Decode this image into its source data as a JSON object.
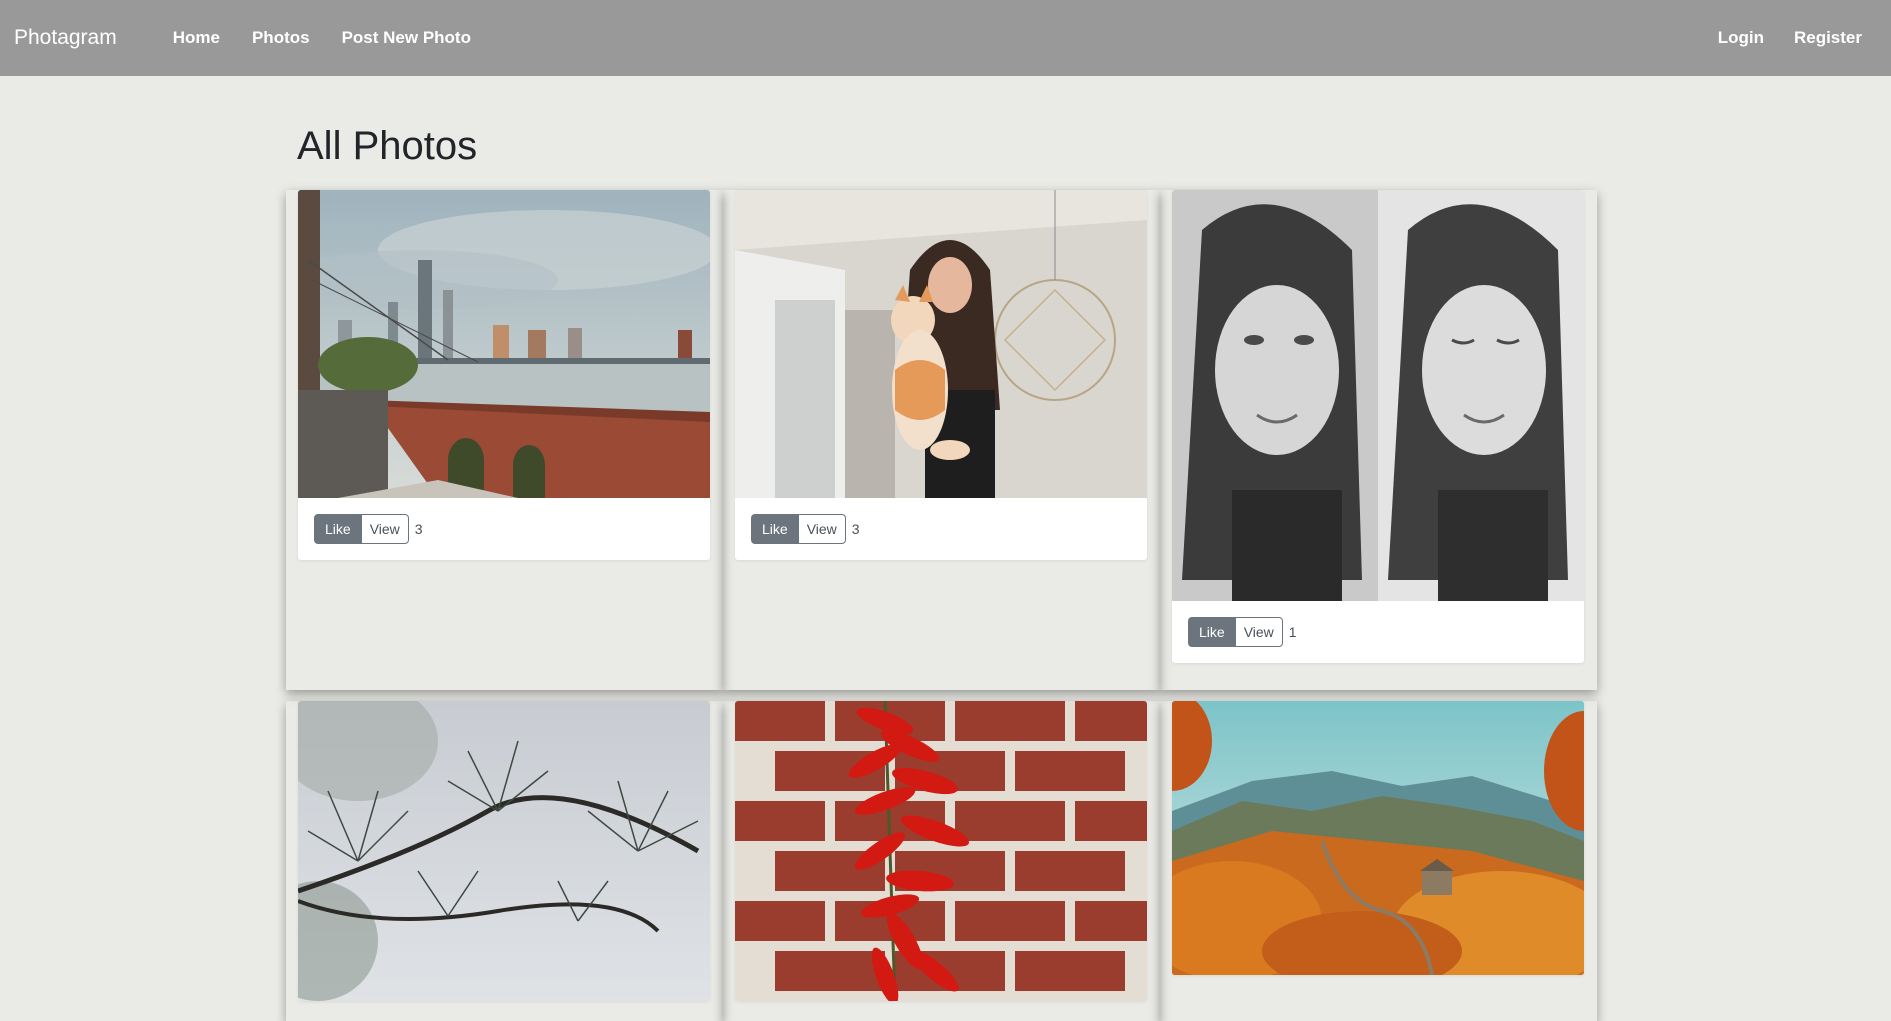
{
  "nav": {
    "brand": "Photagram",
    "links": [
      "Home",
      "Photos",
      "Post New Photo"
    ],
    "right_links": [
      "Login",
      "Register"
    ]
  },
  "page": {
    "title": "All Photos"
  },
  "cards": [
    {
      "like_label": "Like",
      "view_label": "View",
      "likes": "3"
    },
    {
      "like_label": "Like",
      "view_label": "View",
      "likes": "3"
    },
    {
      "like_label": "Like",
      "view_label": "View",
      "likes": "1"
    }
  ],
  "photo_icons": [
    "city-skyline-photo",
    "woman-with-cat-photo",
    "selfie-diptych-photo",
    "pine-branch-photo",
    "red-chili-peppers-photo",
    "great-wall-autumn-photo"
  ]
}
